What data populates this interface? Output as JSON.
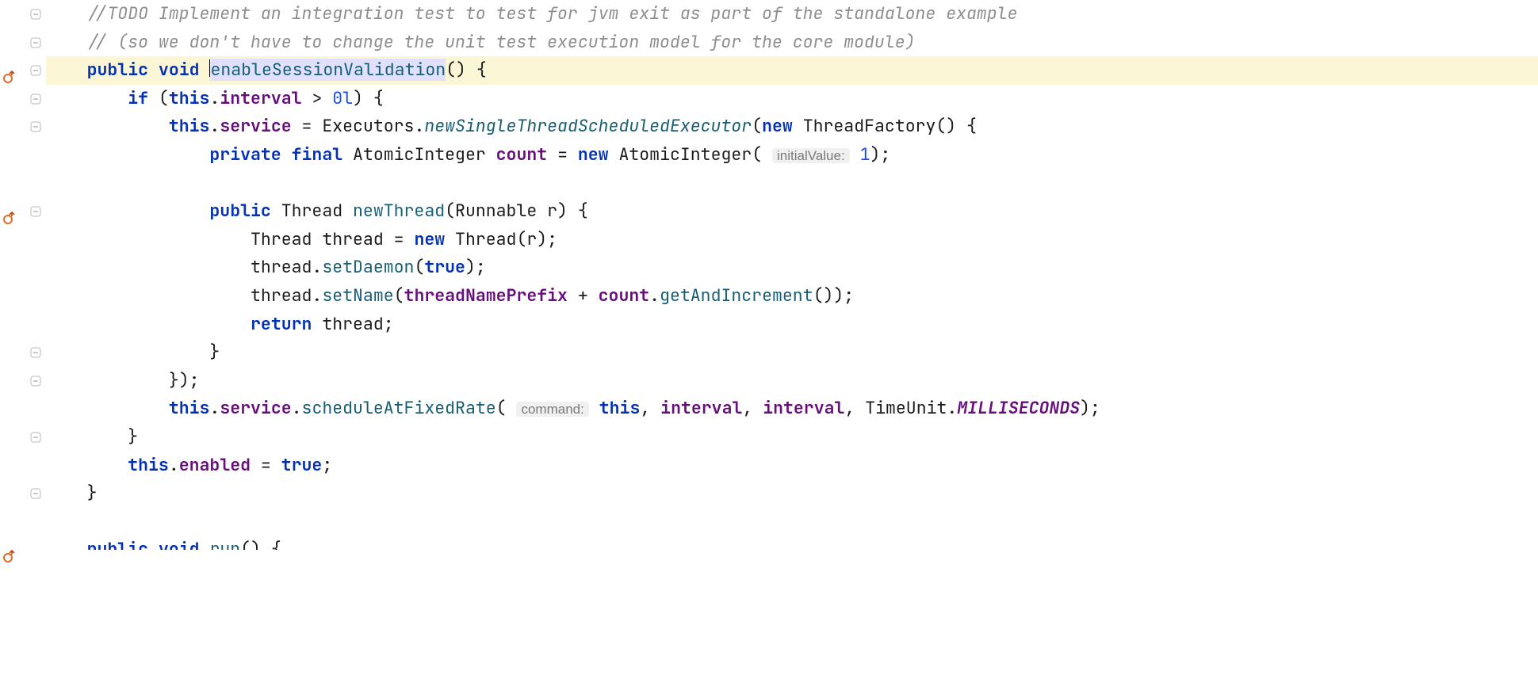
{
  "code": {
    "comment1": "//TODO Implement an integration test to test for jvm exit as part of the standalone example",
    "comment2": "// (so we don't have to change the unit test execution model for the core module)",
    "kw_public": "public",
    "kw_void": "void",
    "method_name": "enableSessionValidation",
    "l3_tail": "() {",
    "kw_if": "if",
    "kw_this": "this",
    "field_interval": "interval",
    "op_gt": " > ",
    "lit_0l": "0l",
    "l4_tail": ") {",
    "l4_head": " (",
    "field_service": "service",
    "op_assign": " = ",
    "type_Executors": "Executors",
    "m_newSingle": "newSingleThreadScheduledExecutor",
    "kw_new": "new",
    "type_ThreadFactory": "ThreadFactory",
    "l5_tail": "() {",
    "kw_private": "private",
    "kw_final": "final",
    "type_AtomicInteger": "AtomicInteger",
    "field_count": "count",
    "hint_initial": "initialValue:",
    "lit_one": "1",
    "paren_semi": ");",
    "type_Thread": "Thread",
    "m_newThread": "newThread",
    "type_Runnable": "Runnable",
    "param_r": " r) {",
    "var_thread": "thread",
    "arg_r": "(r);",
    "m_setDaemon": "setDaemon",
    "kw_true": "true",
    "m_setName": "setName",
    "field_prefix": "threadNameprefix",
    "threadNamePrefix": "threadNamePrefix",
    "op_plus": " + ",
    "m_getAndInc": "getAndIncrement",
    "empty_call": "());",
    "kw_return": "return",
    "ret_tail": " thread;",
    "brace_close": "}",
    "brace_close_semi": "});",
    "m_schedule": "scheduleAtFixedRate",
    "hint_command": "command:",
    "comma_sp": ", ",
    "arg_interval": "interval",
    "type_TimeUnit": "TimeUnit",
    "enum_ms": "MILLISECONDS",
    "field_enabled": "enabled",
    "assign_true_tail": ";",
    "method_run": "run",
    "next_method_head": "public void ",
    "l20_tail": "() {",
    "dot": ".",
    "open_paren": "(",
    "close_paren": ")",
    "space": " ",
    "open_paren_sp": "( "
  },
  "indent": {
    "i0": "",
    "i1": "    ",
    "i2": "        ",
    "i3": "            ",
    "i4": "                ",
    "i5": "                    "
  }
}
